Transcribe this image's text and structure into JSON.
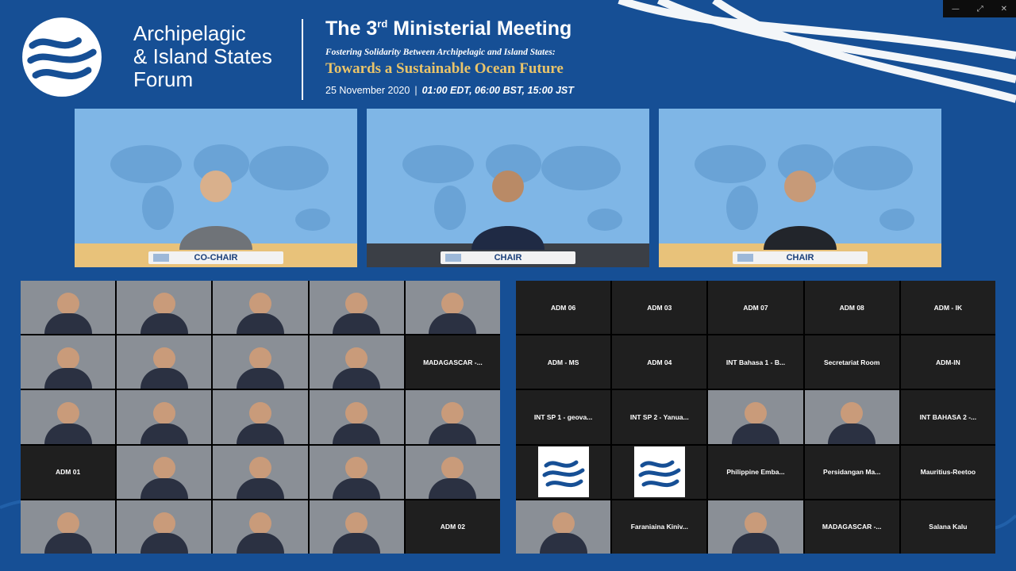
{
  "window_controls": [
    "—",
    "⤢",
    "✕"
  ],
  "forum": {
    "line1": "Archipelagic",
    "line2": "& Island States",
    "line3": "Forum"
  },
  "event": {
    "title": "The 3",
    "title_sup": "rd",
    "title_rest": " Ministerial Meeting",
    "subtitle": "Fostering Solidarity Between Archipelagic and Island States:",
    "theme": "Towards a Sustainable Ocean Future",
    "date": "25 November 2020",
    "times": "01:00 EDT, 06:00 BST, 15:00 JST"
  },
  "panels": [
    {
      "nameplate": "CO-CHAIR"
    },
    {
      "nameplate": "CHAIR"
    },
    {
      "nameplate": "CHAIR"
    }
  ],
  "left_grid": [
    {
      "type": "video",
      "label": ""
    },
    {
      "type": "video",
      "label": ""
    },
    {
      "type": "video",
      "label": ""
    },
    {
      "type": "video",
      "label": ""
    },
    {
      "type": "video",
      "label": ""
    },
    {
      "type": "video",
      "label": ""
    },
    {
      "type": "video",
      "label": ""
    },
    {
      "type": "video",
      "label": ""
    },
    {
      "type": "video",
      "label": ""
    },
    {
      "type": "name",
      "label": "MADAGASCAR -..."
    },
    {
      "type": "video",
      "label": ""
    },
    {
      "type": "video",
      "label": ""
    },
    {
      "type": "video",
      "label": ""
    },
    {
      "type": "video",
      "label": ""
    },
    {
      "type": "video",
      "label": ""
    },
    {
      "type": "name",
      "label": "ADM 01"
    },
    {
      "type": "video",
      "label": ""
    },
    {
      "type": "video",
      "label": ""
    },
    {
      "type": "video",
      "label": ""
    },
    {
      "type": "video",
      "label": ""
    },
    {
      "type": "video",
      "label": ""
    },
    {
      "type": "video",
      "label": ""
    },
    {
      "type": "video",
      "label": ""
    },
    {
      "type": "video",
      "label": ""
    },
    {
      "type": "name",
      "label": "ADM 02"
    }
  ],
  "right_grid": [
    {
      "type": "name",
      "label": "ADM 06"
    },
    {
      "type": "name",
      "label": "ADM 03"
    },
    {
      "type": "name",
      "label": "ADM 07"
    },
    {
      "type": "name",
      "label": "ADM 08"
    },
    {
      "type": "name",
      "label": "ADM - IK"
    },
    {
      "type": "name",
      "label": "ADM - MS"
    },
    {
      "type": "name",
      "label": "ADM 04"
    },
    {
      "type": "name",
      "label": "INT Bahasa 1 - B..."
    },
    {
      "type": "name",
      "label": "Secretariat Room"
    },
    {
      "type": "name",
      "label": "ADM-IN"
    },
    {
      "type": "name",
      "label": "INT SP 1 - geova..."
    },
    {
      "type": "name",
      "label": "INT SP 2 - Yanua..."
    },
    {
      "type": "video",
      "label": ""
    },
    {
      "type": "video",
      "label": ""
    },
    {
      "type": "name",
      "label": "INT BAHASA 2 -..."
    },
    {
      "type": "logo",
      "label": ""
    },
    {
      "type": "logo",
      "label": ""
    },
    {
      "type": "name",
      "label": "Philippine Emba..."
    },
    {
      "type": "name",
      "label": "Persidangan Ma..."
    },
    {
      "type": "name",
      "label": "Mauritius-Reetoo"
    },
    {
      "type": "video",
      "label": ""
    },
    {
      "type": "name",
      "label": "Faraniaina Kiniv..."
    },
    {
      "type": "video",
      "label": ""
    },
    {
      "type": "name",
      "label": "MADAGASCAR -..."
    },
    {
      "type": "name",
      "label": "Salana Kalu"
    }
  ]
}
